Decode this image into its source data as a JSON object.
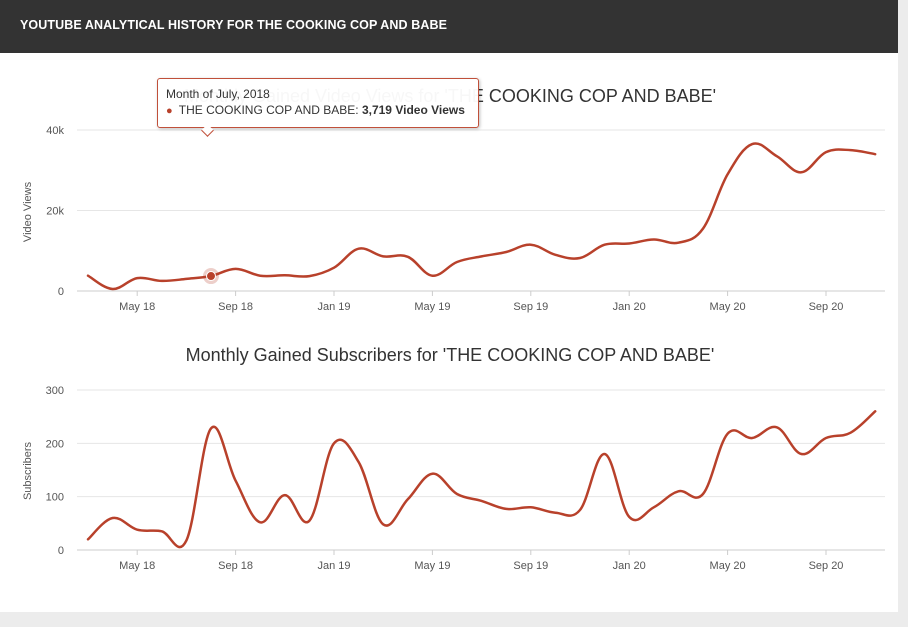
{
  "header": {
    "title": "YOUTUBE ANALYTICAL HISTORY FOR THE COOKING COP AND BABE"
  },
  "colors": {
    "series": "#b8412b",
    "grid": "#e6e6e6",
    "header_bg": "#333333"
  },
  "tooltip": {
    "date": "Month of July, 2018",
    "series_label": "THE COOKING COP AND BABE:",
    "value": "3,719 Video Views"
  },
  "chart_data": [
    {
      "type": "line",
      "title": "Monthly Gained Video Views for 'THE COOKING COP AND BABE'",
      "xlabel": "",
      "ylabel": "Video Views",
      "x_tick_labels": [
        "May 18",
        "Sep 18",
        "Jan 19",
        "May 19",
        "Sep 19",
        "Jan 20",
        "May 20",
        "Sep 20"
      ],
      "y_ticks": [
        0,
        20000,
        40000
      ],
      "y_tick_labels": [
        "0",
        "20k",
        "40k"
      ],
      "ylim": [
        0,
        40000
      ],
      "grid": true,
      "series": [
        {
          "name": "THE COOKING COP AND BABE",
          "highlight_index": 5,
          "values": [
            3800,
            500,
            3200,
            2500,
            3000,
            3719,
            5500,
            3800,
            3900,
            3700,
            5800,
            10500,
            8600,
            8500,
            3800,
            7200,
            8600,
            9700,
            11500,
            9000,
            8200,
            11500,
            11800,
            12800,
            12000,
            15500,
            29000,
            36500,
            33500,
            29500,
            34500,
            35000,
            34000
          ]
        }
      ]
    },
    {
      "type": "line",
      "title": "Monthly Gained Subscribers for 'THE COOKING COP AND BABE'",
      "xlabel": "",
      "ylabel": "Subscribers",
      "x_tick_labels": [
        "May 18",
        "Sep 18",
        "Jan 19",
        "May 19",
        "Sep 19",
        "Jan 20",
        "May 20",
        "Sep 20"
      ],
      "y_ticks": [
        0,
        100,
        200,
        300
      ],
      "y_tick_labels": [
        "0",
        "100",
        "200",
        "300"
      ],
      "ylim": [
        0,
        300
      ],
      "grid": true,
      "series": [
        {
          "name": "THE COOKING COP AND BABE",
          "values": [
            20,
            60,
            38,
            35,
            18,
            228,
            130,
            52,
            103,
            55,
            200,
            165,
            48,
            95,
            143,
            105,
            92,
            77,
            80,
            70,
            75,
            180,
            62,
            80,
            110,
            105,
            218,
            210,
            230,
            180,
            210,
            220,
            260
          ]
        }
      ]
    }
  ]
}
